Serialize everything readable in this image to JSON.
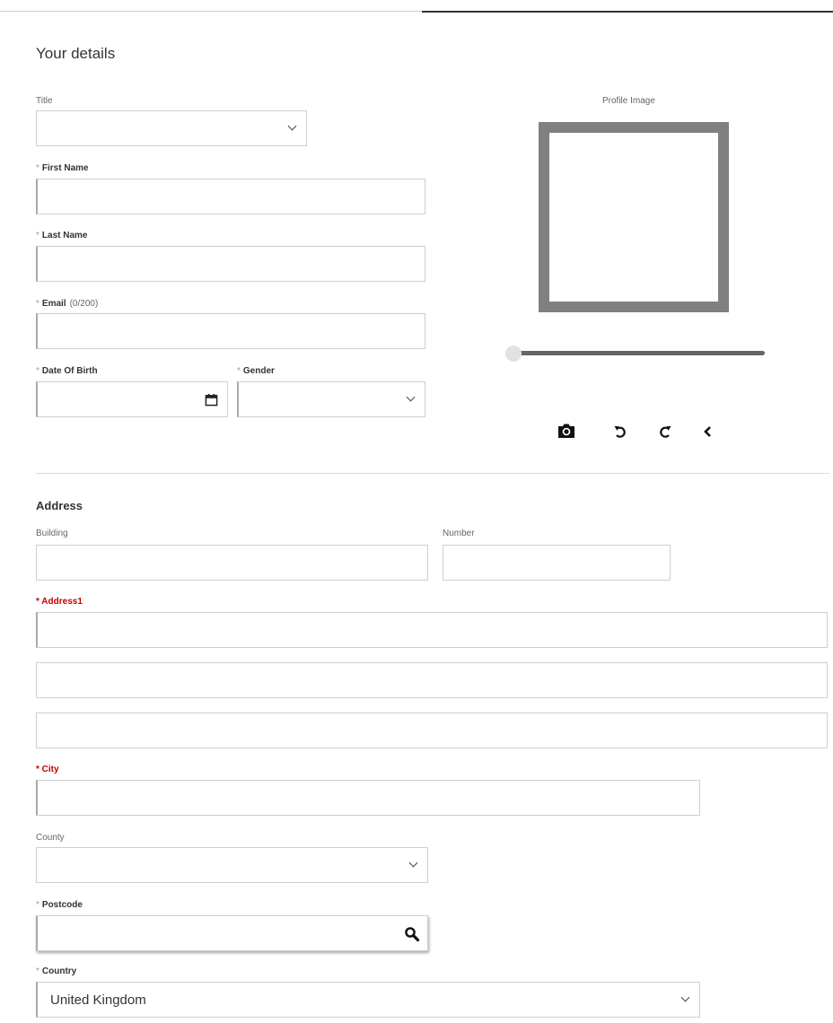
{
  "details": {
    "heading": "Your details",
    "title_label": "Title",
    "title_value": "",
    "first_name": {
      "star": "*",
      "label": "First Name",
      "value": ""
    },
    "last_name": {
      "star": "*",
      "label": "Last Name",
      "value": ""
    },
    "email": {
      "star": "*",
      "label": "Email",
      "counter": "(0/200)",
      "value": ""
    },
    "dob": {
      "star": "*",
      "label": "Date Of Birth",
      "value": ""
    },
    "gender": {
      "star": "*",
      "label": "Gender",
      "value": ""
    }
  },
  "profile": {
    "label": "Profile Image",
    "zoom_level": 0,
    "tools": [
      "camera-icon",
      "rotate-left-icon",
      "rotate-right-icon",
      "back-icon"
    ]
  },
  "address": {
    "title": "Address",
    "building_label": "Building",
    "number_label": "Number",
    "address1_label": "* Address1",
    "city_label": "* City",
    "county_label": "County",
    "postcode": {
      "star": "*",
      "label": "Postcode"
    },
    "country": {
      "star": "*",
      "label": "Country",
      "value": "United Kingdom"
    }
  },
  "colors": {
    "required": "#c00000",
    "frame": "#808080",
    "border": "#cfcfcf"
  }
}
